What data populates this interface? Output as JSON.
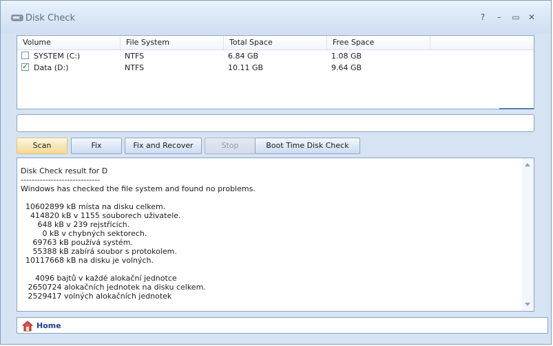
{
  "window": {
    "title": "Disk Check",
    "controls": {
      "help": "?",
      "minimize": "–",
      "maximize": "▭",
      "close": "✕"
    }
  },
  "volumes": {
    "columns": [
      "Volume",
      "File System",
      "Total Space",
      "Free Space"
    ],
    "rows": [
      {
        "volume": "SYSTEM (C:)",
        "fs": "NTFS",
        "total": "6.84 GB",
        "free": "1.08 GB",
        "checked": false
      },
      {
        "volume": "Data (D:)",
        "fs": "NTFS",
        "total": "10.11 GB",
        "free": "9.64 GB",
        "checked": true
      }
    ]
  },
  "path_field": {
    "value": ""
  },
  "buttons": {
    "scan": "Scan",
    "fix": "Fix",
    "fix_recover": "Fix and Recover",
    "stop": "Stop",
    "boot_check": "Boot Time Disk Check"
  },
  "output": {
    "lines": [
      "Disk Check result for D",
      "-----------------------------",
      "Windows has checked the file system and found no problems.",
      "",
      "  10602899 kB místa na disku celkem.",
      "    414820 kB v 1155 souborech uživatele.",
      "       648 kB v 239 rejstřících.",
      "         0 kB v chybných sektorech.",
      "     69763 kB používá systém.",
      "     55388 kB zabírá soubor s protokolem.",
      "  10117668 kB na disku je volných.",
      "",
      "      4096 bajtů v každé alokační jednotce",
      "   2650724 alokačních jednotek na disku celkem.",
      "   2529417 volných alokačních jednotek"
    ]
  },
  "statusbar": {
    "home_label": "Home"
  },
  "colors": {
    "window_bg": "#d6e3f3",
    "border": "#8ba3c3",
    "link_blue": "#1d3e8a",
    "check_green": "#1f7a1f"
  }
}
